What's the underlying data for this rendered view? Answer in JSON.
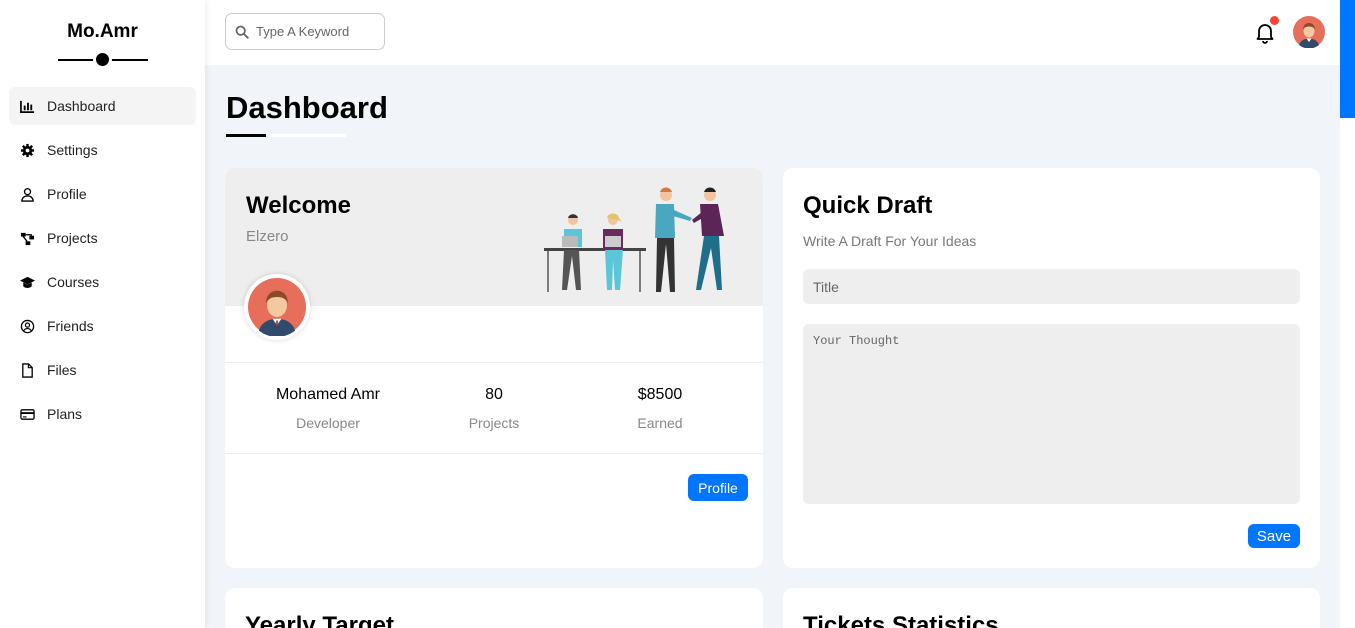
{
  "brand": {
    "name": "Mo.Amr"
  },
  "sidebar": {
    "items": [
      {
        "label": "Dashboard",
        "icon": "chart-bar-icon",
        "active": true
      },
      {
        "label": "Settings",
        "icon": "gear-icon"
      },
      {
        "label": "Profile",
        "icon": "user-icon"
      },
      {
        "label": "Projects",
        "icon": "diagram-project-icon"
      },
      {
        "label": "Courses",
        "icon": "graduation-cap-icon"
      },
      {
        "label": "Friends",
        "icon": "circle-user-icon"
      },
      {
        "label": "Files",
        "icon": "file-icon"
      },
      {
        "label": "Plans",
        "icon": "credit-card-icon"
      }
    ]
  },
  "header": {
    "search_placeholder": "Type A Keyword",
    "has_notification": true
  },
  "page": {
    "title": "Dashboard"
  },
  "welcome": {
    "title": "Welcome",
    "subtitle": "Elzero",
    "stats": [
      {
        "value": "Mohamed Amr",
        "label": "Developer"
      },
      {
        "value": "80",
        "label": "Projects"
      },
      {
        "value": "$8500",
        "label": "Earned"
      }
    ],
    "button": "Profile"
  },
  "draft": {
    "title": "Quick Draft",
    "subtitle": "Write A Draft For Your Ideas",
    "title_placeholder": "Title",
    "thought_placeholder": "Your Thought",
    "button": "Save"
  },
  "bottom_cards": {
    "yearly": "Yearly Target",
    "tickets": "Tickets Statistics"
  },
  "colors": {
    "accent": "#0075ff",
    "notification": "#f44336",
    "page_bg": "#f1f5f9"
  }
}
